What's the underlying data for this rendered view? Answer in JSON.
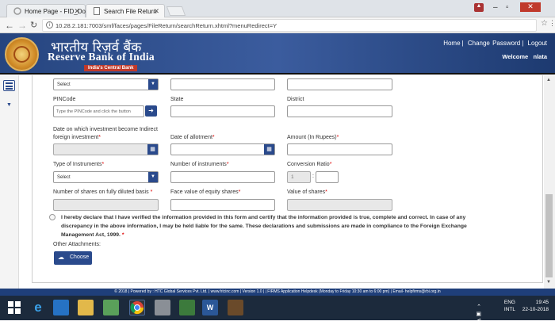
{
  "browser": {
    "tabs": [
      {
        "label": "Home Page - FID_Dome"
      },
      {
        "label": "Search File Return"
      }
    ],
    "url": "10.28.2.181:7003/smf/faces/pages/FileReturn/searchReturn.xhtml?menuRedirect=Y"
  },
  "header": {
    "hindi_name": "भारतीय रिज़र्व बैंक",
    "english_name": "Reserve Bank of India",
    "tagline": "India's Central Bank",
    "nav": [
      "Home",
      "Change Password",
      "Logout"
    ],
    "welcome": "Welcome",
    "user": "nlata"
  },
  "form": {
    "select_placeholder": "Select",
    "pincode_label": "PINCode",
    "pincode_placeholder": "Type the PINCode and click the button",
    "state_label": "State",
    "district_label": "District",
    "investment_date_label_1": "Date on which investment become Indirect",
    "investment_date_label_2": "foreign investment",
    "allotment_label": "Date of allotment",
    "amount_label": "Amount (In Rupees)",
    "instruments_type_label": "Type of Instruments",
    "instruments_count_label": "Number of instruments",
    "conversion_label": "Conversion Ratio",
    "conversion_value": "1",
    "conversion_sep": ":",
    "shares_label": "Number of shares on fully diluted basis",
    "face_value_label": "Face value of equity shares",
    "share_value_label": "Value of shares",
    "required_mark": "*",
    "declaration": "I hereby declare that I have verified the information provided in this form and certify that the information provided is true, complete and correct. In case of any discrepancy in the above information, I may be held liable for the same. These declarations and submissions are made in compliance to the Foreign Exchange Management Act, 1999.",
    "attachments_label": "Other Attachments:",
    "choose_label": "Choose"
  },
  "footer": "© 2018 | Powered by : HTC Global Services Pvt. Ltd. | www.htcinc.com | Version 1.0 | | FIRMS Application Helpdesk (Monday to Friday 10:30 am to 6:00 pm) | Email- helpfirms@rbi.org.in",
  "taskbar": {
    "lang": "ENG",
    "layout": "INTL",
    "time": "19:45",
    "date": "22-10-2018"
  },
  "colors": {
    "brand": "#2a4a8c",
    "required": "#d00"
  }
}
